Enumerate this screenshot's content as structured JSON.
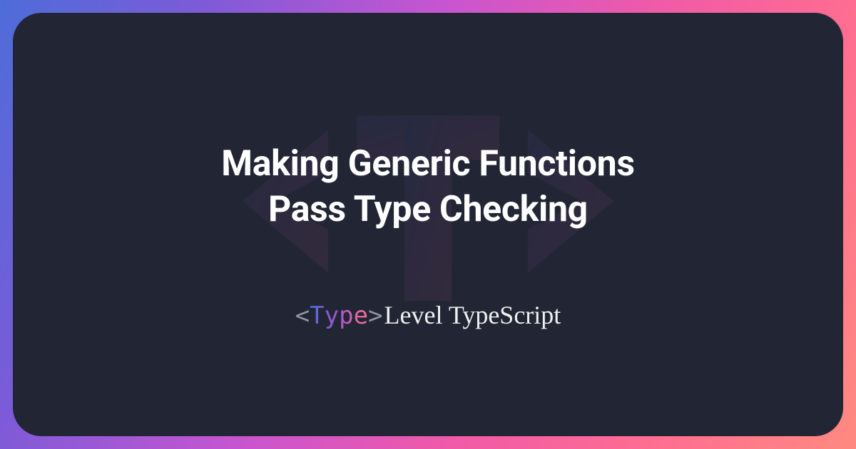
{
  "title": {
    "line1": "Making Generic Functions",
    "line2": "Pass Type Checking"
  },
  "brand": {
    "bracket_open": "<",
    "type_word": "Type",
    "bracket_close": ">",
    "rest": "Level TypeScript"
  },
  "colors": {
    "card_bg": "#222634",
    "gradient_start": "#4d6dd9",
    "gradient_end": "#ff8a80",
    "text": "#ffffff",
    "bracket": "#8e95a6"
  }
}
